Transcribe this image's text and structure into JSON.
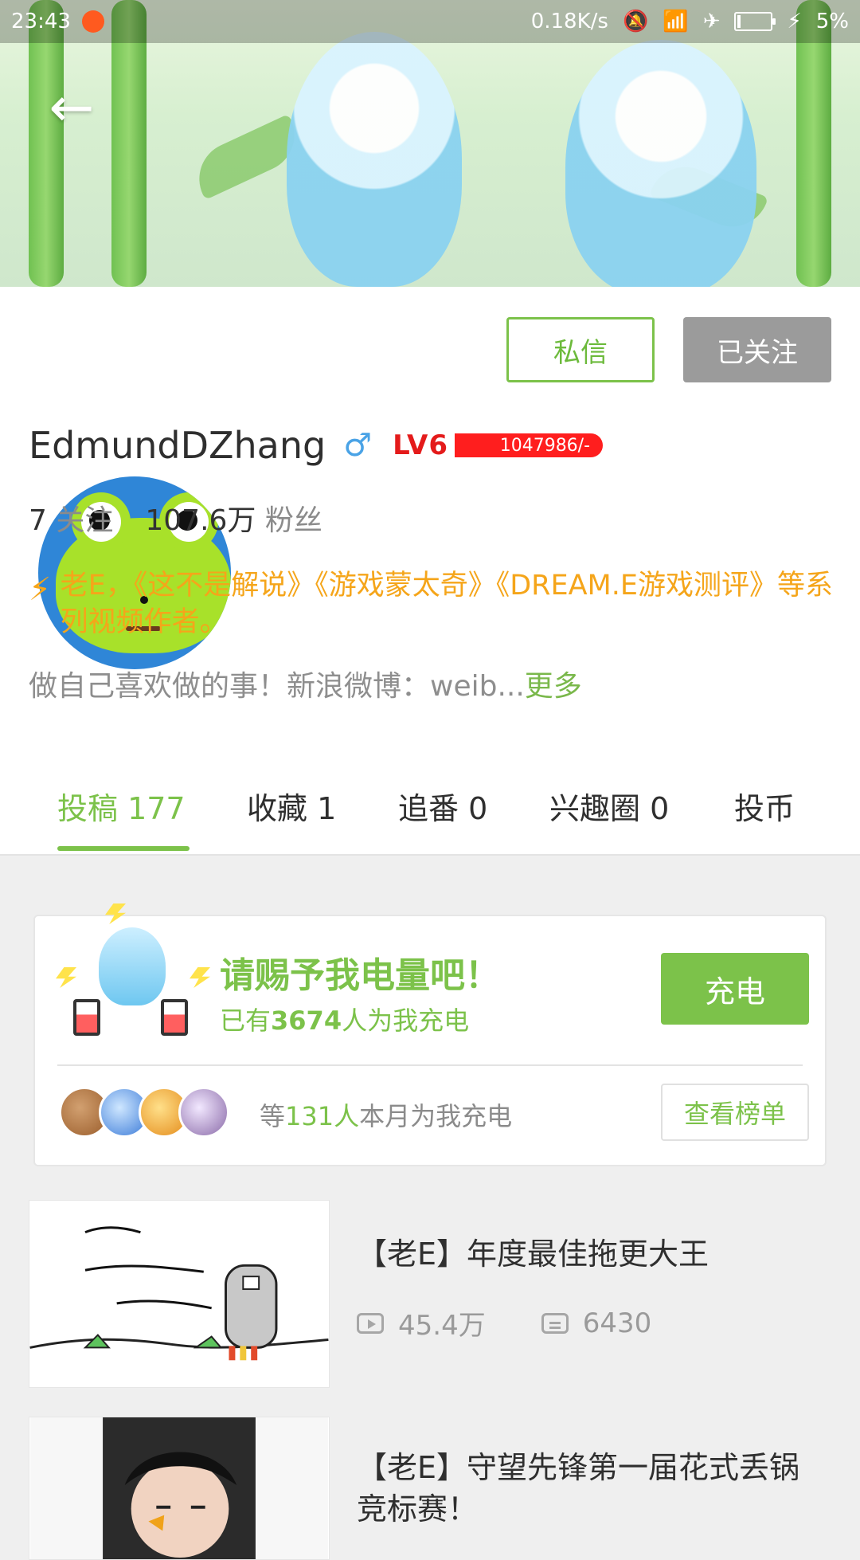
{
  "status_bar": {
    "time": "23:43",
    "net_speed": "0.18K/s",
    "battery_percent": "5%",
    "icons": [
      "notification-app-icon",
      "mute-icon",
      "wifi-icon",
      "airplane-icon",
      "battery-icon",
      "charging-icon"
    ]
  },
  "header": {
    "back_icon": "back-arrow-icon"
  },
  "profile": {
    "username": "EdmundDZhang",
    "gender_symbol": "♂",
    "level_label": "LV6",
    "level_exp": "1047986/-",
    "following_count": "7",
    "following_label": "关注",
    "followers_count": "107.6万",
    "followers_label": "粉丝",
    "verified_description": "老E，《这不是解说》《游戏蒙太奇》《DREAM.E游戏测评》等系列视频作者。",
    "bio": "做自己喜欢做的事！新浪微博：weib...",
    "bio_more": "更多",
    "buttons": {
      "message": "私信",
      "following": "已关注"
    },
    "colors": {
      "accent_green": "#7cc24a",
      "verified_orange": "#f5a51a",
      "level_red": "#e41b1b"
    }
  },
  "tabs": [
    {
      "label": "投稿 177",
      "active": true
    },
    {
      "label": "收藏 1",
      "active": false
    },
    {
      "label": "追番 0",
      "active": false
    },
    {
      "label": "兴趣圈 0",
      "active": false
    },
    {
      "label": "投币",
      "active": false
    }
  ],
  "charge": {
    "title": "请赐予我电量吧！",
    "subtitle_prefix": "已有",
    "subtitle_count": "3674",
    "subtitle_suffix": "人为我充电",
    "button": "充电",
    "note_prefix": "等",
    "note_count": "131人",
    "note_suffix": "本月为我充电",
    "ranking_button": "查看榜单"
  },
  "videos": [
    {
      "title": "【老E】年度最佳拖更大王",
      "views": "45.4万",
      "comments": "6430"
    },
    {
      "title": "【老E】守望先锋第一届花式丢锅竞标赛！",
      "views": "",
      "comments": ""
    }
  ]
}
